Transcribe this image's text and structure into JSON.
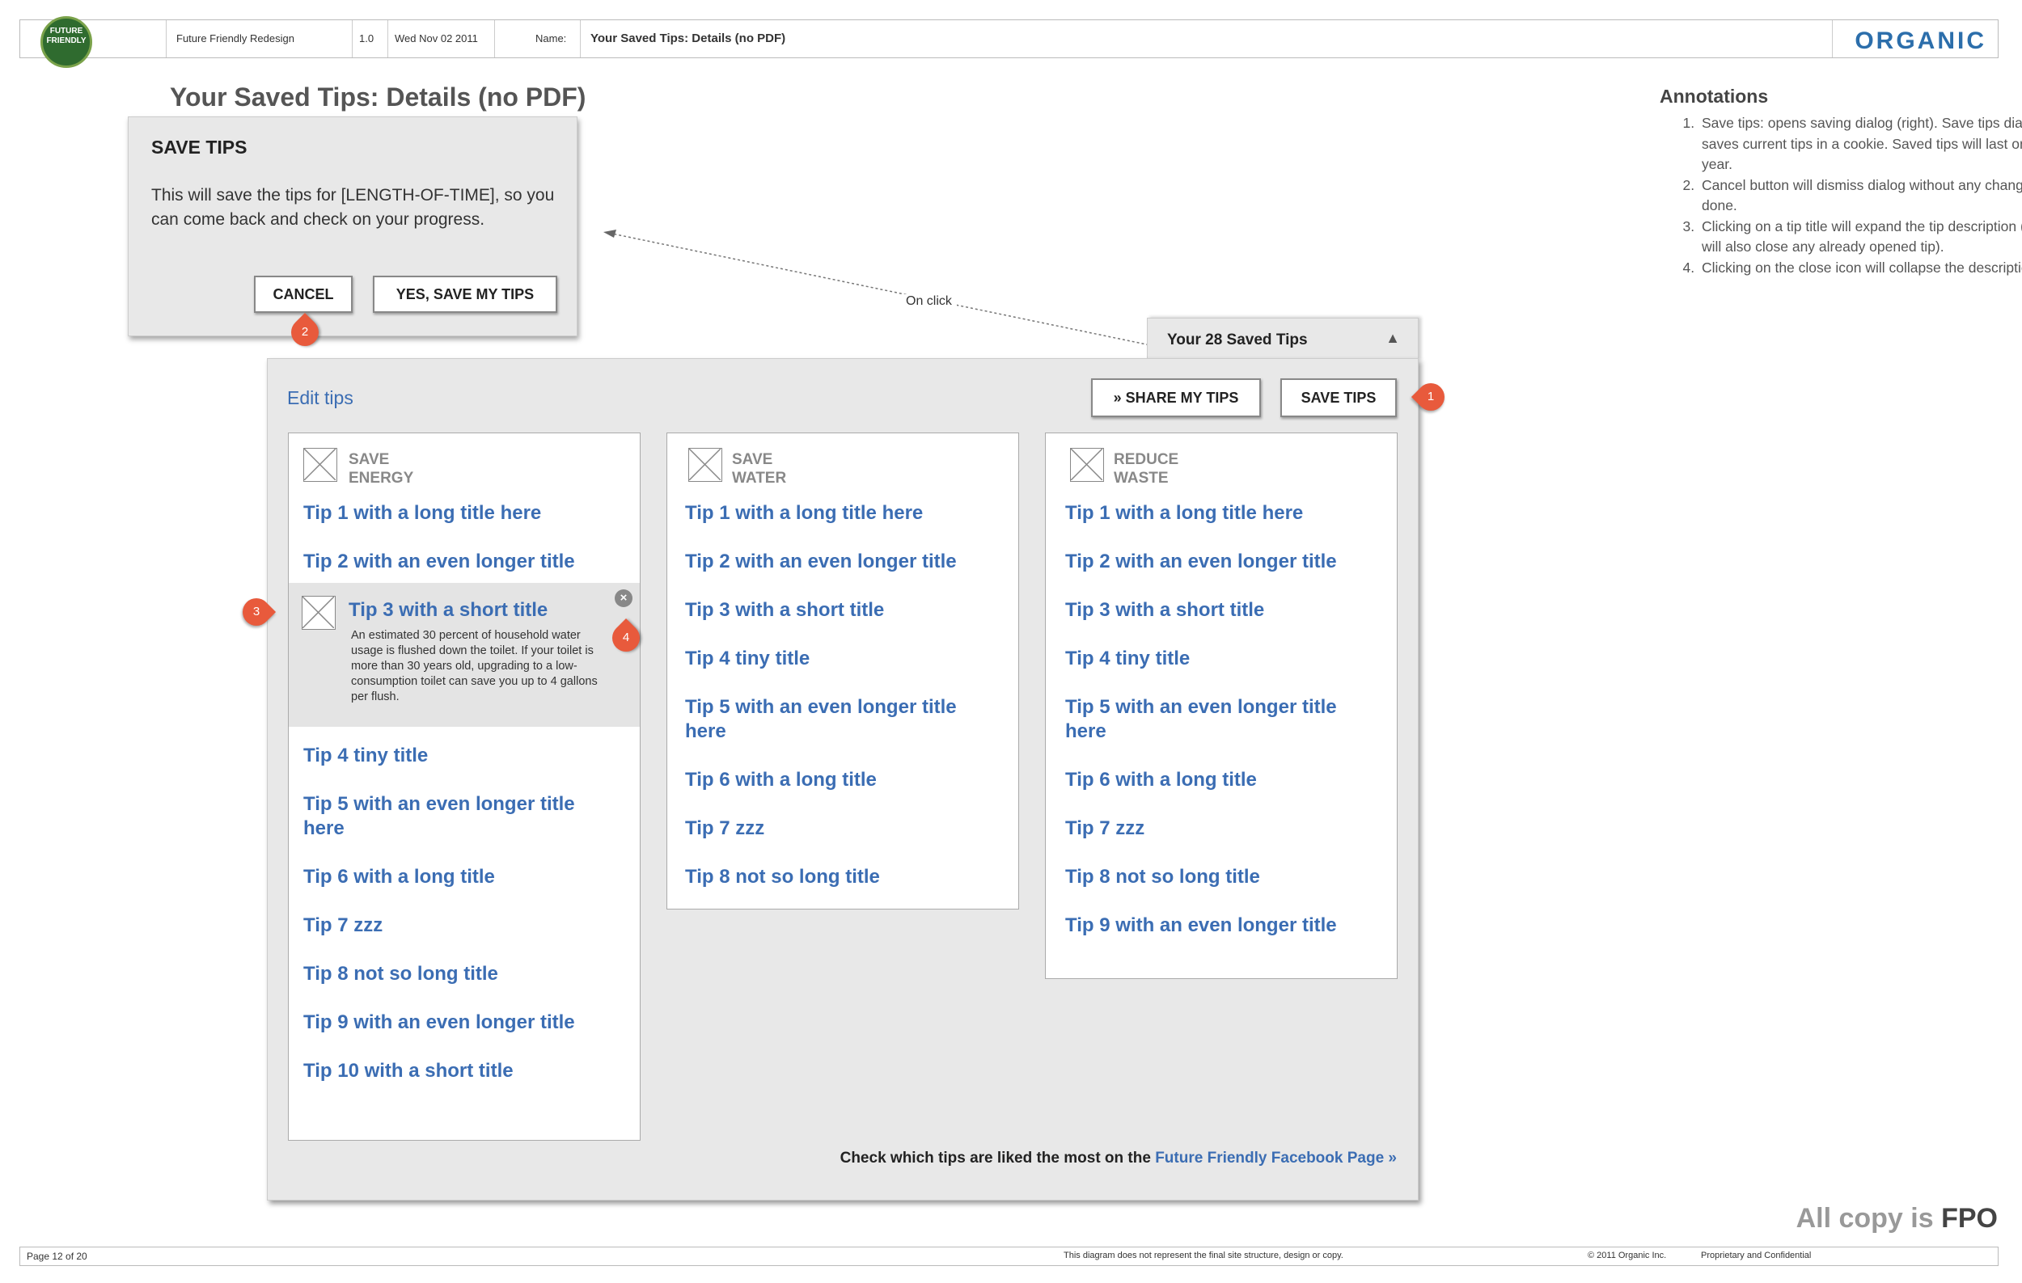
{
  "header": {
    "logo_text": "FUTURE FRIENDLY",
    "project": "Future Friendly Redesign",
    "version": "1.0",
    "date": "Wed Nov 02 2011",
    "name_label": "Name:",
    "name_value": "Your Saved Tips: Details (no PDF)",
    "brand": "ORGANIC"
  },
  "page_title": "Your Saved Tips: Details (no PDF)",
  "annotations": {
    "title": "Annotations",
    "items": [
      "Save tips: opens saving dialog (right). Save tips dialog saves current tips in a cookie. Saved tips will last one year.",
      "Cancel button will dismiss dialog without any changes done.",
      "Clicking on a tip title will expand the tip description (it will also close any already opened tip).",
      "Clicking on the close icon will collapse the description."
    ]
  },
  "dialog": {
    "title": "SAVE TIPS",
    "body": "This will save the tips for [LENGTH-OF-TIME], so you can come back and check on your progress.",
    "cancel_label": "CANCEL",
    "save_label": "YES, SAVE MY TIPS"
  },
  "connector_label": "On click",
  "saved_tab": {
    "label": "Your 28 Saved Tips",
    "arrow": "▲"
  },
  "panel": {
    "edit_label": "Edit tips",
    "share_label": "» SHARE MY TIPS",
    "save_label": "SAVE TIPS",
    "footer_text": "Check which tips are liked the most on the ",
    "footer_link": "Future Friendly Facebook Page »"
  },
  "columns": [
    {
      "category_line1": "SAVE",
      "category_line2": "ENERGY",
      "tips": [
        "Tip 1 with a long title here",
        "Tip 2 with an even longer title",
        "Tip 3 with a short title",
        "Tip 4 tiny title",
        "Tip 5 with an even longer title here",
        "Tip 6 with a long title",
        "Tip 7 zzz",
        "Tip 8 not so long title",
        "Tip 9 with an even longer title",
        "Tip 10 with a short title"
      ],
      "expanded_description": "An estimated 30 percent of household water usage is flushed down the toilet. If your toilet is more than 30 years old, upgrading to a low-consumption toilet can save you up to 4 gallons per flush."
    },
    {
      "category_line1": "SAVE",
      "category_line2": "WATER",
      "tips": [
        "Tip 1 with a long title here",
        "Tip 2 with an even longer title",
        "Tip 3 with a short title",
        "Tip 4 tiny title",
        "Tip 5 with an even longer title here",
        "Tip 6 with a long title",
        "Tip 7 zzz",
        "Tip 8 not so long title"
      ]
    },
    {
      "category_line1": "REDUCE",
      "category_line2": "WASTE",
      "tips": [
        "Tip 1 with a long title here",
        "Tip 2 with an even longer title",
        "Tip 3 with a short title",
        "Tip 4 tiny title",
        "Tip 5 with an even longer title here",
        "Tip 6 with a long title",
        "Tip 7 zzz",
        "Tip 8 not so long title",
        "Tip 9 with an even longer title"
      ]
    }
  ],
  "markers": [
    "1",
    "2",
    "3",
    "4"
  ],
  "fpo": {
    "prefix": "All copy is ",
    "bold": "FPO"
  },
  "footer": {
    "page": "Page 12 of 20",
    "disclaimer": "This diagram does not represent the final site structure, design or copy.",
    "copyright": "© 2011 Organic Inc.",
    "confidential": "Proprietary and Confidential"
  },
  "colors": {
    "link": "#3b6db3",
    "marker": "#e85a3c",
    "brand": "#2c6eab"
  }
}
